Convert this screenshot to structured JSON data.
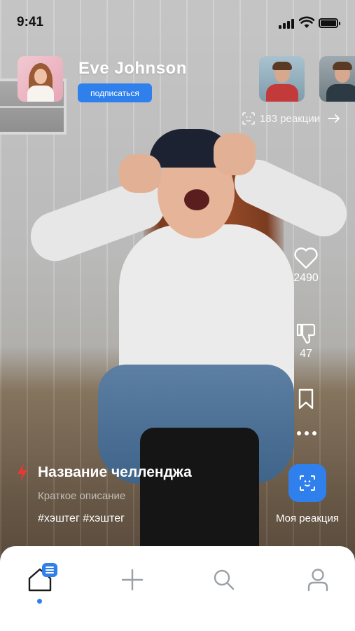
{
  "status_bar": {
    "time": "9:41"
  },
  "profile": {
    "name": "Eve Johnson",
    "subscribe_label": "подписаться"
  },
  "reactions": {
    "count_text": "183 реакции"
  },
  "actions": {
    "likes": "2490",
    "dislikes": "47",
    "my_reaction_label": "Моя реакция"
  },
  "challenge": {
    "title": "Название челленджа",
    "description": "Краткое описание",
    "hashtags": "#хэштег #хэштег"
  },
  "nav": {
    "items": [
      "home-icon",
      "plus-icon",
      "search-icon",
      "profile-icon"
    ],
    "active": "home-icon"
  },
  "colors": {
    "accent": "#2f80ed",
    "bolt": "#e53935"
  }
}
